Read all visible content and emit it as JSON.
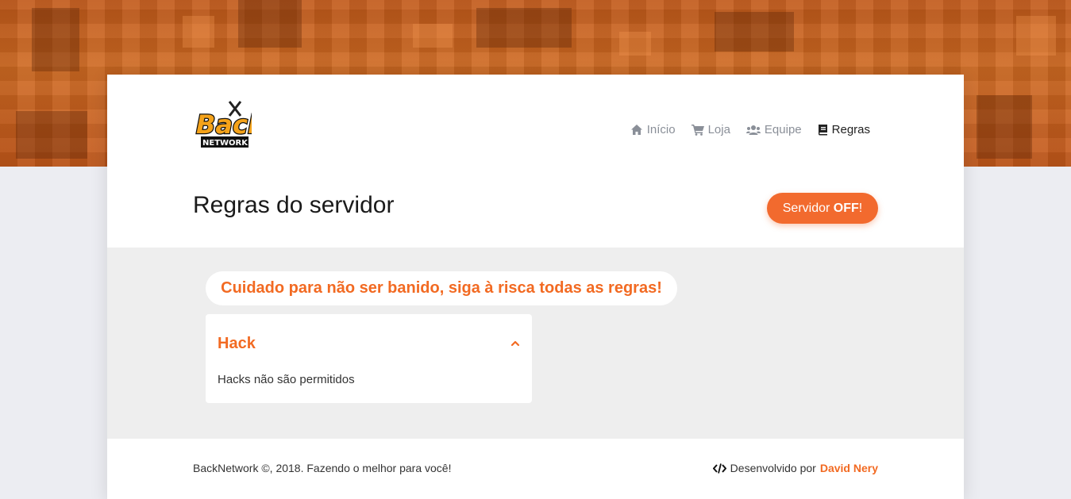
{
  "nav": {
    "items": [
      {
        "label": "Início",
        "icon": "home-icon"
      },
      {
        "label": "Loja",
        "icon": "cart-icon"
      },
      {
        "label": "Equipe",
        "icon": "users-icon"
      },
      {
        "label": "Regras",
        "icon": "book-icon",
        "active": true
      }
    ]
  },
  "logo": {
    "line1": "Back",
    "line2": "NETWORK"
  },
  "page": {
    "title": "Regras do servidor"
  },
  "server_status": {
    "prefix": "Servidor ",
    "status": "OFF",
    "suffix": "!"
  },
  "warning": "Cuidado para não ser banido, siga à risca todas as regras!",
  "rules": [
    {
      "title": "Hack",
      "description": "Hacks não são permitidos",
      "expanded": true
    }
  ],
  "footer": {
    "copyright": "BackNetwork ©, 2018. Fazendo o melhor para você!",
    "dev_prefix": "Desenvolvido por",
    "dev_name": "David Nery"
  },
  "colors": {
    "accent": "#f26a22",
    "banner": "#c85f1c",
    "button": "#f26a2e"
  }
}
